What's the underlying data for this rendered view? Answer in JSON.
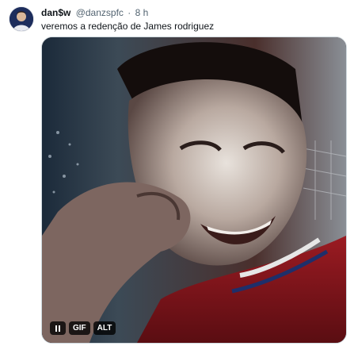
{
  "tweet": {
    "display_name": "dan$w",
    "handle": "@danzspfc",
    "separator": "·",
    "time": "8 h",
    "text": "veremos a redenção de James rodriguez"
  },
  "media": {
    "gif_badge": "GIF",
    "alt_badge": "ALT",
    "pause_icon": "pause-icon"
  },
  "colors": {
    "text_primary": "#0f1419",
    "text_secondary": "#536471",
    "media_border": "#cfd9de"
  }
}
